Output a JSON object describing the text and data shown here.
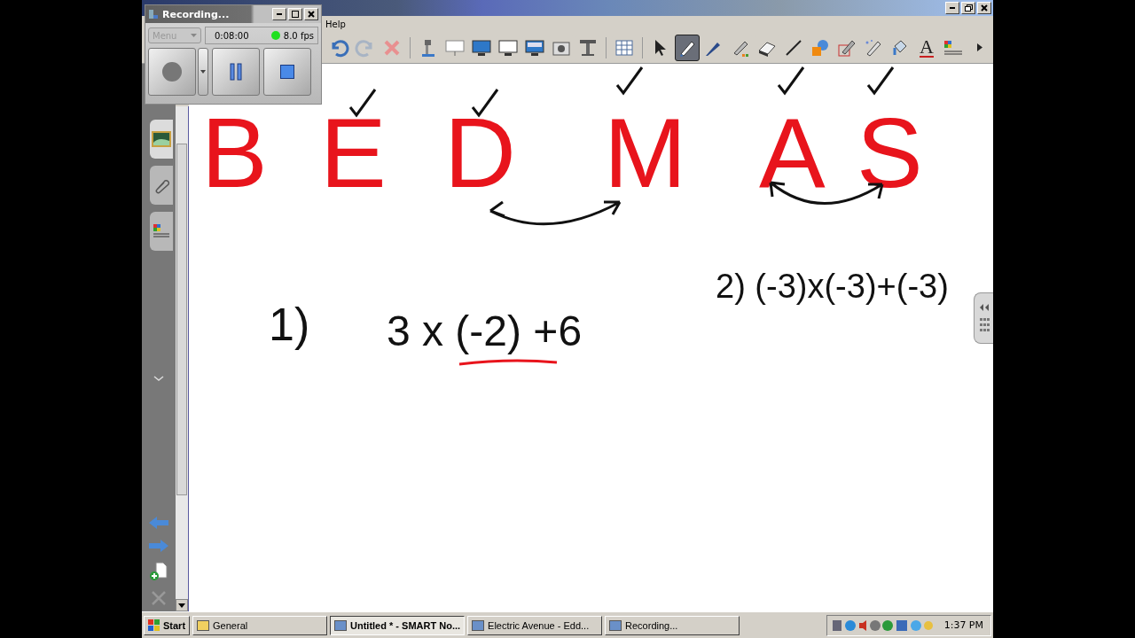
{
  "recorder": {
    "title": "Recording...",
    "menu": "Menu",
    "time": "0:08:00",
    "fps": "8.0 fps"
  },
  "menu": [
    "Help"
  ],
  "tool_groups": [
    [
      {
        "kind": "undo",
        "selected": false
      },
      {
        "kind": "redo",
        "selected": false
      },
      {
        "kind": "delete",
        "selected": false
      }
    ],
    [
      {
        "kind": "document-camera",
        "selected": false
      },
      {
        "kind": "projector-screen",
        "selected": false
      },
      {
        "kind": "monitor",
        "selected": false
      },
      {
        "kind": "screen-capture",
        "selected": false
      },
      {
        "kind": "monitor-shade",
        "selected": false
      },
      {
        "kind": "camera",
        "selected": false
      },
      {
        "kind": "document-stand",
        "selected": false
      }
    ],
    [
      {
        "kind": "table",
        "selected": false
      }
    ],
    [
      {
        "kind": "select",
        "selected": false
      },
      {
        "kind": "pen",
        "selected": true
      },
      {
        "kind": "calligraphy-pen",
        "selected": false
      },
      {
        "kind": "creative-pen",
        "selected": false
      },
      {
        "kind": "eraser",
        "selected": false
      },
      {
        "kind": "line",
        "selected": false
      },
      {
        "kind": "shapes",
        "selected": false
      },
      {
        "kind": "shape-pen",
        "selected": false
      },
      {
        "kind": "magic-pen",
        "selected": false
      },
      {
        "kind": "fill",
        "selected": false
      },
      {
        "kind": "text",
        "selected": false,
        "label": "A"
      },
      {
        "kind": "properties",
        "selected": false
      },
      {
        "kind": "more",
        "selected": false
      }
    ]
  ],
  "sidebar_tabs": [
    {
      "kind": "gallery",
      "selected": true
    },
    {
      "kind": "attachment",
      "selected": false
    },
    {
      "kind": "properties",
      "selected": false
    }
  ],
  "letters": [
    "B",
    "E",
    "D",
    "M",
    "A",
    "S"
  ],
  "expressions": [
    "1)",
    "3 x (-2) +6",
    "2) (-3)x(-3)+(-3)"
  ],
  "taskbar": {
    "start": "Start",
    "tasks": [
      {
        "label": "General",
        "selected": false
      },
      {
        "label": "Untitled * - SMART No...",
        "selected": true
      },
      {
        "label": "Electric Avenue - Edd...",
        "selected": false
      },
      {
        "label": "Recording...",
        "selected": false
      }
    ],
    "clock": "1:37 PM"
  }
}
